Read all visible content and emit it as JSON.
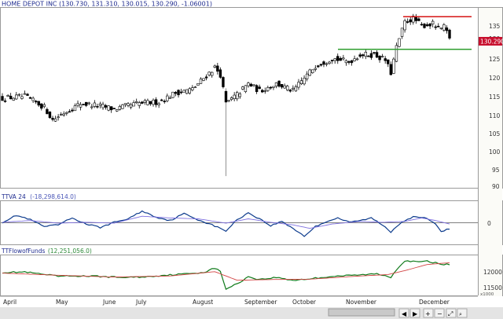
{
  "panels": {
    "price": {
      "title": "HOME DEPOT INC (130.730, 131.310, 130.015, 130.290, -1.06001)",
      "last_value": "130.290",
      "ticks": [
        "135",
        "130",
        "125",
        "120",
        "115",
        "110",
        "105",
        "100",
        "95",
        "90"
      ],
      "colors": {
        "title": "#1e2b8f",
        "resistance": "#d61414",
        "support": "#2f9e2f",
        "up_body": "#ffffff",
        "down_body": "#000000"
      }
    },
    "ttva": {
      "title": "TTVA 24",
      "reading": "(-18,298,614.0)",
      "ticks": [
        "0"
      ],
      "colors": {
        "main": "#0b3a8c",
        "signal": "#7d6fe0"
      }
    },
    "flow": {
      "title": "TTFlowofFunds",
      "reading": "(12,251,056.0)",
      "ticks": [
        "12000",
        "11500"
      ],
      "scale_note": "x1000",
      "colors": {
        "main": "#0f7a1a",
        "signal": "#d24343"
      }
    }
  },
  "chart_data": [
    {
      "type": "candlestick",
      "title": "HOME DEPOT INC",
      "ylim": [
        89,
        138
      ],
      "categories": [
        "April",
        "May",
        "June",
        "July",
        "August",
        "September",
        "October",
        "November",
        "December"
      ],
      "levels": {
        "resistance": 136,
        "support": 127
      },
      "anchors": [
        {
          "i": 0,
          "v": 113.5
        },
        {
          "i": 8,
          "v": 114.0
        },
        {
          "i": 15,
          "v": 111.0
        },
        {
          "i": 18,
          "v": 107.5
        },
        {
          "i": 22,
          "v": 109.5
        },
        {
          "i": 28,
          "v": 112.0
        },
        {
          "i": 34,
          "v": 111.5
        },
        {
          "i": 40,
          "v": 110.5
        },
        {
          "i": 48,
          "v": 112.0
        },
        {
          "i": 56,
          "v": 112.5
        },
        {
          "i": 62,
          "v": 115.0
        },
        {
          "i": 68,
          "v": 116.0
        },
        {
          "i": 72,
          "v": 119.0
        },
        {
          "i": 76,
          "v": 122.0
        },
        {
          "i": 78,
          "v": 120.0
        },
        {
          "i": 80,
          "v": 112.0
        },
        {
          "i": 84,
          "v": 114.5
        },
        {
          "i": 88,
          "v": 117.5
        },
        {
          "i": 92,
          "v": 115.5
        },
        {
          "i": 98,
          "v": 117.5
        },
        {
          "i": 104,
          "v": 115.5
        },
        {
          "i": 108,
          "v": 119.0
        },
        {
          "i": 112,
          "v": 122.5
        },
        {
          "i": 118,
          "v": 124.5
        },
        {
          "i": 124,
          "v": 123.5
        },
        {
          "i": 128,
          "v": 125.5
        },
        {
          "i": 133,
          "v": 125.5
        },
        {
          "i": 137,
          "v": 124.0
        },
        {
          "i": 139,
          "v": 120.5
        },
        {
          "i": 141,
          "v": 127.5
        },
        {
          "i": 144,
          "v": 134.5
        },
        {
          "i": 147,
          "v": 135.5
        },
        {
          "i": 150,
          "v": 133.5
        },
        {
          "i": 154,
          "v": 134.0
        },
        {
          "i": 156,
          "v": 132.5
        },
        {
          "i": 158,
          "v": 133.0
        },
        {
          "i": 160,
          "v": 130.3
        }
      ],
      "spike": {
        "i": 80,
        "low": 92.0
      }
    },
    {
      "type": "line",
      "title": "TTVA 24",
      "ylim": [
        -1,
        1
      ],
      "series": [
        {
          "anchors": [
            {
              "i": 0,
              "v": 0.05
            },
            {
              "i": 5,
              "v": 0.45
            },
            {
              "i": 10,
              "v": 0.2
            },
            {
              "i": 15,
              "v": -0.2
            },
            {
              "i": 20,
              "v": -0.1
            },
            {
              "i": 25,
              "v": 0.3
            },
            {
              "i": 30,
              "v": -0.05
            },
            {
              "i": 35,
              "v": -0.25
            },
            {
              "i": 40,
              "v": 0.05
            },
            {
              "i": 45,
              "v": 0.25
            },
            {
              "i": 50,
              "v": 0.7
            },
            {
              "i": 55,
              "v": 0.35
            },
            {
              "i": 60,
              "v": 0.15
            },
            {
              "i": 65,
              "v": 0.55
            },
            {
              "i": 70,
              "v": 0.2
            },
            {
              "i": 75,
              "v": -0.1
            },
            {
              "i": 80,
              "v": -0.45
            },
            {
              "i": 84,
              "v": 0.2
            },
            {
              "i": 88,
              "v": 0.6
            },
            {
              "i": 92,
              "v": 0.25
            },
            {
              "i": 96,
              "v": -0.15
            },
            {
              "i": 100,
              "v": 0.1
            },
            {
              "i": 104,
              "v": -0.3
            },
            {
              "i": 108,
              "v": -0.75
            },
            {
              "i": 112,
              "v": -0.2
            },
            {
              "i": 116,
              "v": 0.1
            },
            {
              "i": 120,
              "v": 0.3
            },
            {
              "i": 124,
              "v": 0.05
            },
            {
              "i": 128,
              "v": 0.15
            },
            {
              "i": 132,
              "v": 0.3
            },
            {
              "i": 136,
              "v": -0.1
            },
            {
              "i": 139,
              "v": -0.5
            },
            {
              "i": 143,
              "v": 0.1
            },
            {
              "i": 147,
              "v": 0.35
            },
            {
              "i": 151,
              "v": 0.3
            },
            {
              "i": 154,
              "v": 0.1
            },
            {
              "i": 157,
              "v": -0.45
            },
            {
              "i": 160,
              "v": -0.35
            }
          ]
        },
        {
          "anchors": [
            {
              "i": 0,
              "v": 0.05
            },
            {
              "i": 10,
              "v": 0.15
            },
            {
              "i": 20,
              "v": 0.0
            },
            {
              "i": 30,
              "v": 0.05
            },
            {
              "i": 40,
              "v": 0.0
            },
            {
              "i": 50,
              "v": 0.4
            },
            {
              "i": 60,
              "v": 0.3
            },
            {
              "i": 70,
              "v": 0.25
            },
            {
              "i": 80,
              "v": 0.0
            },
            {
              "i": 88,
              "v": 0.25
            },
            {
              "i": 96,
              "v": 0.05
            },
            {
              "i": 104,
              "v": -0.1
            },
            {
              "i": 110,
              "v": -0.3
            },
            {
              "i": 118,
              "v": -0.05
            },
            {
              "i": 128,
              "v": 0.1
            },
            {
              "i": 136,
              "v": 0.05
            },
            {
              "i": 144,
              "v": 0.1
            },
            {
              "i": 150,
              "v": 0.3
            },
            {
              "i": 155,
              "v": 0.15
            },
            {
              "i": 160,
              "v": -0.05
            }
          ]
        }
      ]
    },
    {
      "type": "line",
      "title": "TTFlowofFunds",
      "ylim": [
        11380,
        12390
      ],
      "series": [
        {
          "anchors": [
            {
              "i": 0,
              "v": 11980
            },
            {
              "i": 8,
              "v": 11990
            },
            {
              "i": 14,
              "v": 11930
            },
            {
              "i": 20,
              "v": 11870
            },
            {
              "i": 26,
              "v": 11880
            },
            {
              "i": 34,
              "v": 11870
            },
            {
              "i": 42,
              "v": 11840
            },
            {
              "i": 50,
              "v": 11850
            },
            {
              "i": 58,
              "v": 11900
            },
            {
              "i": 66,
              "v": 11940
            },
            {
              "i": 72,
              "v": 11980
            },
            {
              "i": 76,
              "v": 12100
            },
            {
              "i": 78,
              "v": 12000
            },
            {
              "i": 80,
              "v": 11520
            },
            {
              "i": 84,
              "v": 11660
            },
            {
              "i": 88,
              "v": 11860
            },
            {
              "i": 92,
              "v": 11780
            },
            {
              "i": 98,
              "v": 11840
            },
            {
              "i": 104,
              "v": 11760
            },
            {
              "i": 110,
              "v": 11800
            },
            {
              "i": 118,
              "v": 11870
            },
            {
              "i": 126,
              "v": 11900
            },
            {
              "i": 134,
              "v": 11940
            },
            {
              "i": 139,
              "v": 11850
            },
            {
              "i": 142,
              "v": 12150
            },
            {
              "i": 144,
              "v": 12310
            },
            {
              "i": 148,
              "v": 12270
            },
            {
              "i": 152,
              "v": 12290
            },
            {
              "i": 156,
              "v": 12230
            },
            {
              "i": 160,
              "v": 12190
            }
          ]
        },
        {
          "anchors": [
            {
              "i": 0,
              "v": 11960
            },
            {
              "i": 20,
              "v": 11900
            },
            {
              "i": 40,
              "v": 11850
            },
            {
              "i": 60,
              "v": 11880
            },
            {
              "i": 76,
              "v": 12000
            },
            {
              "i": 84,
              "v": 11760
            },
            {
              "i": 96,
              "v": 11780
            },
            {
              "i": 110,
              "v": 11790
            },
            {
              "i": 126,
              "v": 11870
            },
            {
              "i": 138,
              "v": 11920
            },
            {
              "i": 144,
              "v": 12030
            },
            {
              "i": 152,
              "v": 12200
            },
            {
              "i": 160,
              "v": 12250
            }
          ]
        }
      ]
    }
  ]
}
